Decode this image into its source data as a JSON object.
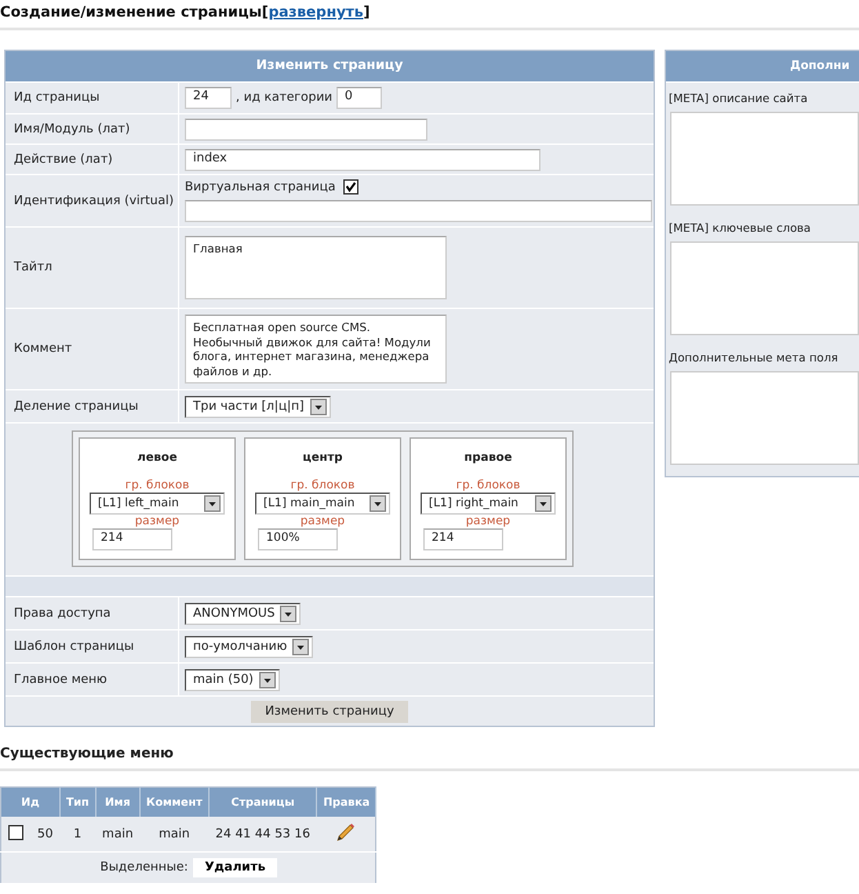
{
  "page_title": {
    "text": "Создание/изменение страницы",
    "bracket_open": "[",
    "link": "развернуть",
    "bracket_close": "]"
  },
  "form": {
    "header": "Изменить страницу",
    "rows": [
      {
        "kind": "id",
        "label": "Ид страницы",
        "value": "24",
        "category_label": ", ид категории",
        "category_value": "0"
      },
      {
        "kind": "input",
        "label": "Имя/Модуль (лат)"
      },
      {
        "kind": "input",
        "label": "Действие (лат)",
        "value": "index"
      },
      {
        "kind": "virtual",
        "label": "Идентификация (virtual)",
        "checkbox_label": "Виртуальная страница",
        "checked": true
      },
      {
        "kind": "textarea",
        "label": "Тайтл",
        "value": "Главная"
      },
      {
        "kind": "textarea",
        "label": "Коммент",
        "value": "Бесплатная open source CMS. Необычный движок для сайта! Модули блога, интернет магазина, менеджера файлов и др."
      },
      {
        "kind": "select",
        "label": "Деление страницы",
        "value": "Три части [л|ц|п]"
      },
      {
        "kind": "columns",
        "columns": [
          {
            "title": "левое",
            "group_label": "гр. блоков",
            "group_value": "[L1] left_main",
            "size_label": "размер",
            "size_value": "214"
          },
          {
            "title": "центр",
            "group_label": "гр. блоков",
            "group_value": "[L1] main_main",
            "size_label": "размер",
            "size_value": "100%"
          },
          {
            "title": "правое",
            "group_label": "гр. блоков",
            "group_value": "[L1] right_main",
            "size_label": "размер",
            "size_value": "214"
          }
        ]
      },
      {
        "kind": "spacer"
      },
      {
        "kind": "select",
        "label": "Права доступа",
        "value": "ANONYMOUS"
      },
      {
        "kind": "select",
        "label": "Шаблон страницы",
        "value": "по-умолчанию"
      },
      {
        "kind": "select",
        "label": "Главное меню",
        "value": "main (50)"
      }
    ],
    "submit": "Изменить страницу"
  },
  "meta_panel": {
    "header": "Дополни",
    "fields": [
      "[META] описание сайта",
      "[META] ключевые слова",
      "Дополнительные мета поля"
    ]
  },
  "menus": {
    "title": "Существующие меню",
    "columns": [
      "Ид",
      "Тип",
      "Имя",
      "Коммент",
      "Страницы",
      "Правка"
    ],
    "rows": [
      {
        "checked": false,
        "id": "50",
        "type": "1",
        "name": "main",
        "comment": "main",
        "pages": "24 41 44 53 16"
      }
    ],
    "selected_label": "Выделенные:",
    "delete_button": "Удалить"
  }
}
